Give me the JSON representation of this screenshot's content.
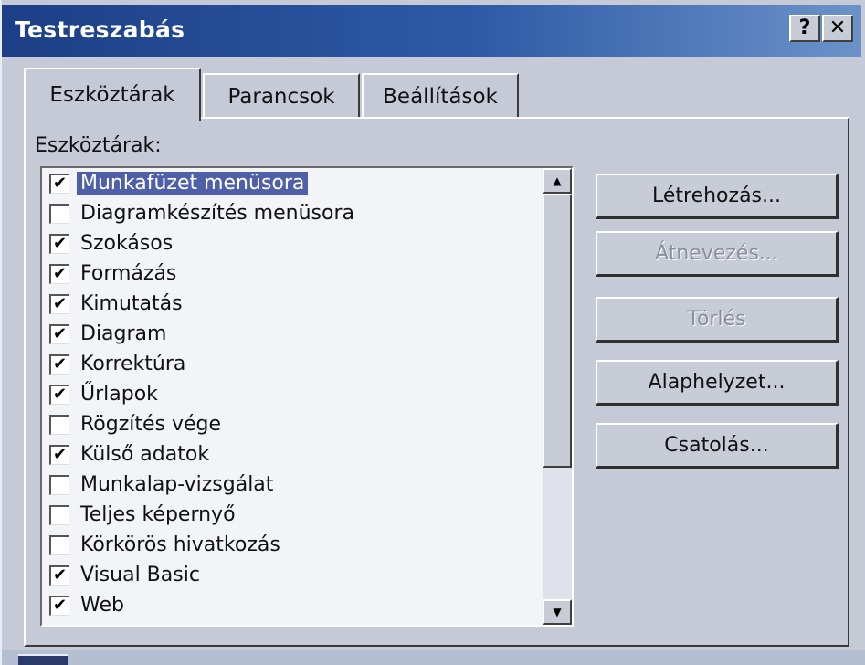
{
  "window": {
    "title": "Testreszabás",
    "help_glyph": "?",
    "close_glyph": "✕"
  },
  "tabs": [
    {
      "label": "Eszköztárak",
      "active": true
    },
    {
      "label": "Parancsok",
      "active": false
    },
    {
      "label": "Beállítások",
      "active": false
    }
  ],
  "toolbar_list": {
    "label": "Eszköztárak:",
    "items": [
      {
        "label": "Munkafüzet menüsora",
        "checked": true,
        "selected": true
      },
      {
        "label": "Diagramkészítés menüsora",
        "checked": false,
        "selected": false
      },
      {
        "label": "Szokásos",
        "checked": true,
        "selected": false
      },
      {
        "label": "Formázás",
        "checked": true,
        "selected": false
      },
      {
        "label": "Kimutatás",
        "checked": true,
        "selected": false
      },
      {
        "label": "Diagram",
        "checked": true,
        "selected": false
      },
      {
        "label": "Korrektúra",
        "checked": true,
        "selected": false
      },
      {
        "label": "Űrlapok",
        "checked": true,
        "selected": false
      },
      {
        "label": "Rögzítés vége",
        "checked": false,
        "selected": false
      },
      {
        "label": "Külső adatok",
        "checked": true,
        "selected": false
      },
      {
        "label": "Munkalap-vizsgálat",
        "checked": false,
        "selected": false
      },
      {
        "label": "Teljes képernyő",
        "checked": false,
        "selected": false
      },
      {
        "label": "Körkörös hivatkozás",
        "checked": false,
        "selected": false
      },
      {
        "label": "Visual Basic",
        "checked": true,
        "selected": false
      },
      {
        "label": "Web",
        "checked": true,
        "selected": false
      }
    ],
    "check_glyph": "✔"
  },
  "buttons": {
    "create": "Létrehozás...",
    "rename": "Átnevezés...",
    "delete": "Törlés",
    "reset": "Alaphelyzet...",
    "attach": "Csatolás..."
  },
  "colors": {
    "titlebar": "#1c3f86",
    "selection": "#5060a8",
    "face": "#c5cad6"
  }
}
